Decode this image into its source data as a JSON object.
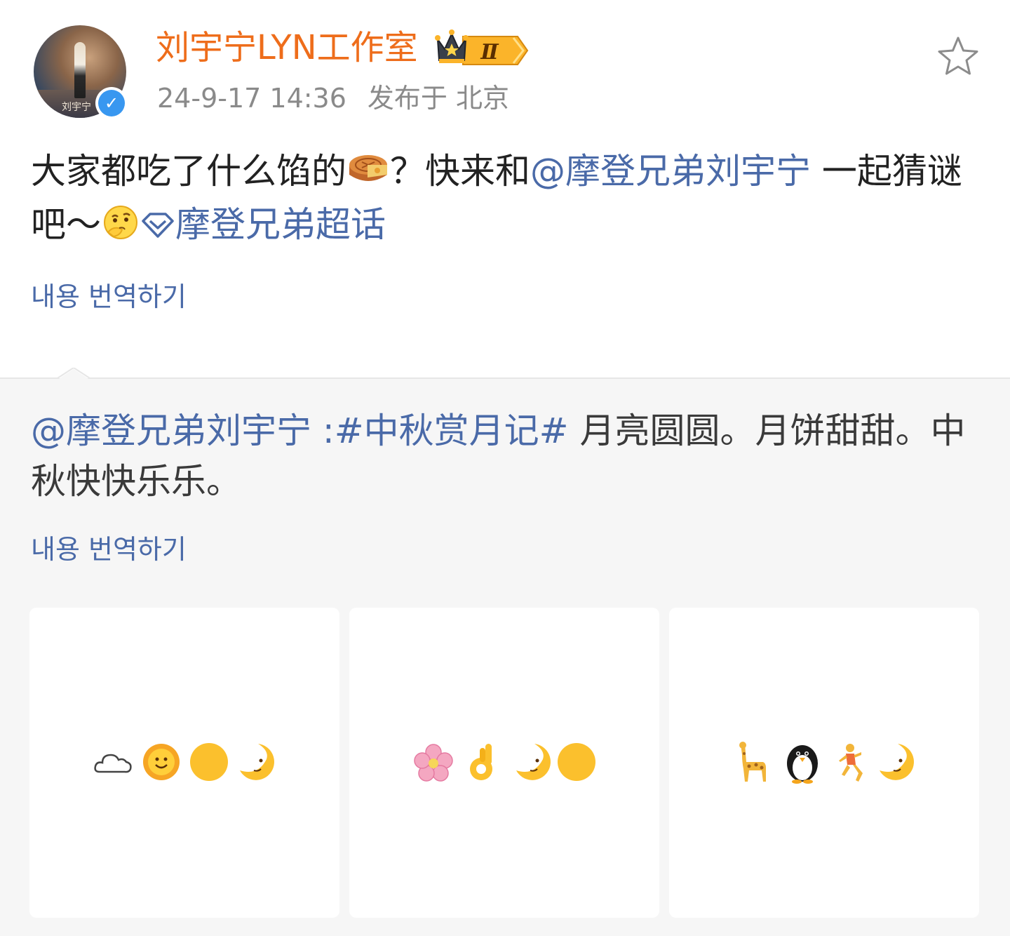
{
  "header": {
    "username": "刘宇宁LYN工作室",
    "badge_level": "Ⅱ",
    "timestamp": "24-9-17 14:36",
    "location": "发布于 北京",
    "avatar_caption": "刘宇宁"
  },
  "post": {
    "text_1": "大家都吃了什么馅的",
    "text_2": "？快来和",
    "mention": "@摩登兄弟刘宇宁",
    "text_3": " 一起猜谜吧～",
    "topic": "摩登兄弟超话",
    "translate_label": "내용 번역하기"
  },
  "repost": {
    "mention": "@摩登兄弟刘宇宁",
    "colon": " :",
    "hashtag": "#中秋赏月记#",
    "text": " 月亮圆圆。月饼甜甜。中秋快快乐乐。",
    "translate_label": "내용 번역하기",
    "images": [
      {
        "icons": [
          "cloud-icon",
          "sun-face-icon",
          "full-moon-icon",
          "crescent-moon-face-icon"
        ]
      },
      {
        "icons": [
          "cherry-blossom-icon",
          "ok-hand-icon",
          "crescent-moon-face-icon",
          "full-moon-icon"
        ]
      },
      {
        "icons": [
          "giraffe-icon",
          "penguin-icon",
          "runner-icon",
          "crescent-moon-face-icon"
        ]
      }
    ]
  },
  "colors": {
    "username": "#ee6d1b",
    "link": "#4a6aa8",
    "meta": "#8a8a8a",
    "text": "#222222",
    "repost_bg": "#f6f6f6",
    "verified": "#3897f0",
    "moon": "#fbc02d"
  }
}
